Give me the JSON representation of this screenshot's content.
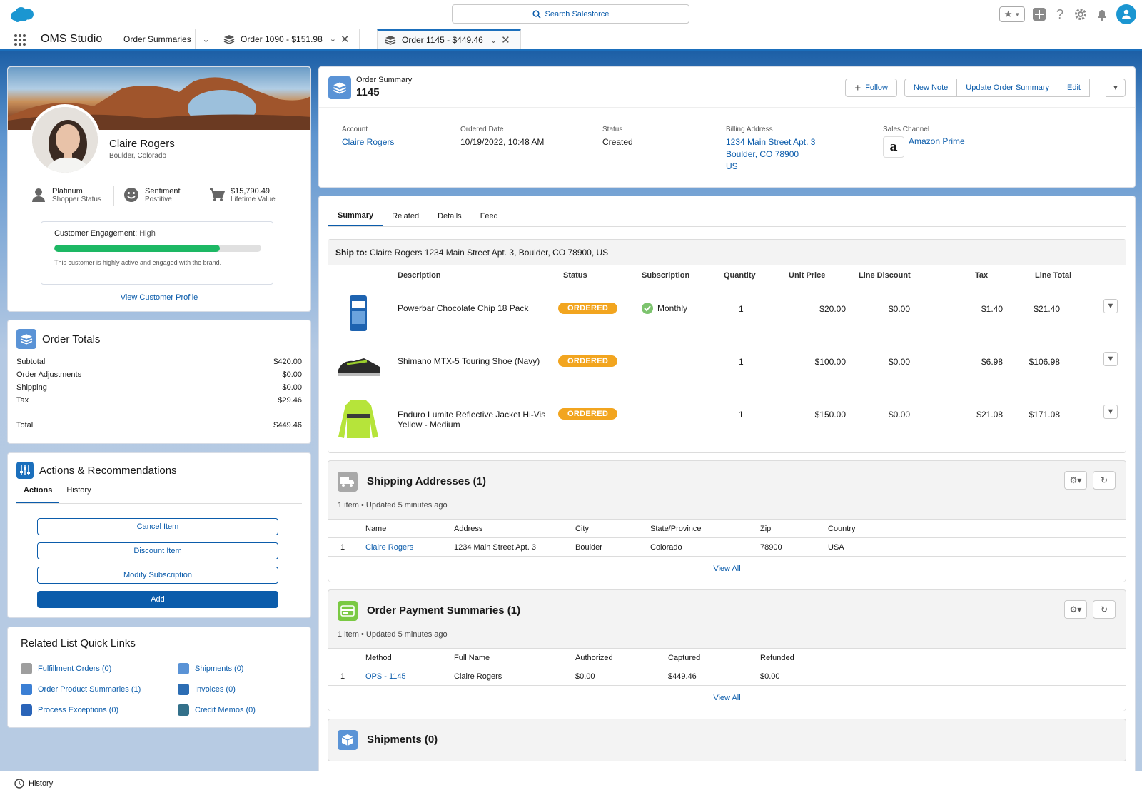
{
  "header": {
    "search_placeholder": "Search Salesforce",
    "app_name": "OMS Studio",
    "tabs": [
      {
        "label": "Order Summaries"
      },
      {
        "label": "Order 1090 - $151.98"
      },
      {
        "label": "Order 1145 - $449.46"
      }
    ]
  },
  "profile": {
    "name": "Claire Rogers",
    "location": "Boulder, Colorado",
    "stats": [
      {
        "title": "Platinum",
        "sub": "Shopper Status",
        "icon": "person-icon"
      },
      {
        "title": "Sentiment",
        "sub": "Postitive",
        "icon": "smile-icon"
      },
      {
        "title": "$15,790.49",
        "sub": "Lifetime Value",
        "icon": "cart-icon"
      }
    ],
    "engagement_label": "Customer Engagement:",
    "engagement_value": "High",
    "engagement_level_pct": 80,
    "engagement_note": "This customer is highly active and engaged with the brand.",
    "view_profile": "View Customer Profile"
  },
  "order_totals": {
    "title": "Order Totals",
    "rows": [
      {
        "label": "Subtotal",
        "value": "$420.00"
      },
      {
        "label": "Order Adjustments",
        "value": "$0.00"
      },
      {
        "label": "Shipping",
        "value": "$0.00"
      },
      {
        "label": "Tax",
        "value": "$29.46"
      }
    ],
    "total_label": "Total",
    "total_value": "$449.46"
  },
  "actions": {
    "title": "Actions & Recommendations",
    "tabs": [
      "Actions",
      "History"
    ],
    "buttons": [
      "Cancel Item",
      "Discount Item",
      "Modify Subscription"
    ],
    "add": "Add"
  },
  "quick_links": {
    "title": "Related List Quick Links",
    "items": [
      {
        "label": "Fulfillment Orders (0)",
        "color": "#9e9e9e"
      },
      {
        "label": "Shipments (0)",
        "color": "#5a93d6"
      },
      {
        "label": "Order Product Summaries (1)",
        "color": "#3b7fd4"
      },
      {
        "label": "Invoices (0)",
        "color": "#2c6db3"
      },
      {
        "label": "Process Exceptions (0)",
        "color": "#2a64b8"
      },
      {
        "label": "Credit Memos (0)",
        "color": "#33708a"
      }
    ]
  },
  "order_summary": {
    "object_label": "Order Summary",
    "number": "1145",
    "buttons": {
      "follow": "Follow",
      "new_note": "New Note",
      "update": "Update Order Summary",
      "edit": "Edit"
    },
    "fields": {
      "account_label": "Account",
      "account": "Claire Rogers",
      "date_label": "Ordered Date",
      "date": "10/19/2022, 10:48 AM",
      "status_label": "Status",
      "status": "Created",
      "billing_label": "Billing Address",
      "billing1": "1234 Main Street Apt. 3",
      "billing2": "Boulder, CO 78900",
      "billing3": "US",
      "channel_label": "Sales Channel",
      "channel": "Amazon Prime"
    }
  },
  "detail_tabs": [
    "Summary",
    "Related",
    "Details",
    "Feed"
  ],
  "ship_to": {
    "label": "Ship to:",
    "value": "Claire Rogers  1234 Main Street Apt. 3, Boulder, CO 78900, US"
  },
  "items_table": {
    "headers": [
      "Description",
      "Status",
      "Subscription",
      "Quantity",
      "Unit Price",
      "Line Discount",
      "Tax",
      "Line Total"
    ],
    "rows": [
      {
        "desc1": "Powerbar Chocolate Chip 18 Pack",
        "desc2": "",
        "status": "ORDERED",
        "subscription": "Monthly",
        "qty": "1",
        "unit": "$20.00",
        "disc": "$0.00",
        "tax": "$1.40",
        "total": "$21.40"
      },
      {
        "desc1": "Shimano MTX-5 Touring Shoe (Navy)",
        "desc2": "",
        "status": "ORDERED",
        "subscription": "",
        "qty": "1",
        "unit": "$100.00",
        "disc": "$0.00",
        "tax": "$6.98",
        "total": "$106.98"
      },
      {
        "desc1": "Enduro Lumite Reflective Jacket Hi-Vis",
        "desc2": "Yellow - Medium",
        "status": "ORDERED",
        "subscription": "",
        "qty": "1",
        "unit": "$150.00",
        "disc": "$0.00",
        "tax": "$21.08",
        "total": "$171.08"
      }
    ]
  },
  "shipping_addresses": {
    "title": "Shipping Addresses (1)",
    "meta": "1 item • Updated 5 minutes ago",
    "headers": [
      "Name",
      "Address",
      "City",
      "State/Province",
      "Zip",
      "Country"
    ],
    "row": {
      "num": "1",
      "name": "Claire Rogers",
      "address": "1234 Main Street Apt. 3",
      "city": "Boulder",
      "state": "Colorado",
      "zip": "78900",
      "country": "USA"
    },
    "view_all": "View All"
  },
  "payment_summaries": {
    "title": "Order Payment Summaries (1)",
    "meta": "1 item • Updated 5 minutes ago",
    "headers": [
      "Method",
      "Full Name",
      "Authorized",
      "Captured",
      "Refunded"
    ],
    "row": {
      "num": "1",
      "method": "OPS - 1145",
      "name": "Claire Rogers",
      "authorized": "$0.00",
      "captured": "$449.46",
      "refunded": "$0.00"
    },
    "view_all": "View All"
  },
  "shipments": {
    "title": "Shipments (0)"
  },
  "footer": {
    "history": "History"
  },
  "colors": {
    "brand": "#0b5cab",
    "accent": "#1b96d1",
    "badge": "#f2a51f",
    "progress": "#1db864"
  }
}
